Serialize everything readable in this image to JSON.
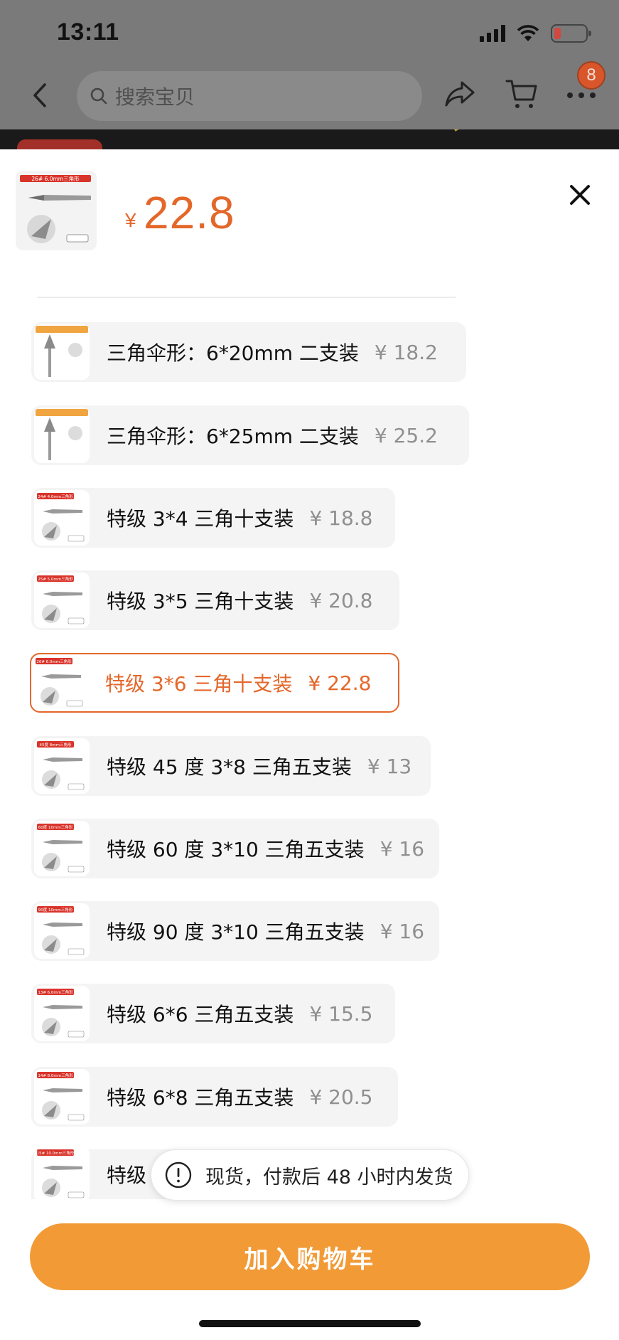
{
  "status_bar": {
    "time": "13:11"
  },
  "nav": {
    "search_placeholder": "搜索宝贝",
    "cart_badge": "8"
  },
  "header": {
    "thumb_tag": "26# 6.0mm三角形",
    "currency": "¥",
    "price": "22.8"
  },
  "options": [
    {
      "label": "三角伞形：6*20mm 二支装",
      "price": "¥ 18.2",
      "selected": false,
      "thumb_tag": ""
    },
    {
      "label": "三角伞形：6*25mm 二支装",
      "price": "¥ 25.2",
      "selected": false,
      "thumb_tag": ""
    },
    {
      "label": "特级 3*4 三角十支装",
      "price": "¥ 18.8",
      "selected": false,
      "thumb_tag": "24# 4.0mm三角形"
    },
    {
      "label": "特级 3*5 三角十支装",
      "price": "¥ 20.8",
      "selected": false,
      "thumb_tag": "25# 5.0mm三角形"
    },
    {
      "label": "特级 3*6 三角十支装",
      "price": "¥ 22.8",
      "selected": true,
      "thumb_tag": "26# 6.0mm三角形"
    },
    {
      "label": "特级 45 度 3*8 三角五支装",
      "price": "¥ 13",
      "selected": false,
      "thumb_tag": "45度 8mm三角形"
    },
    {
      "label": "特级 60 度 3*10 三角五支装",
      "price": "¥ 16",
      "selected": false,
      "thumb_tag": "60度 10mm三角形"
    },
    {
      "label": "特级 90 度 3*10 三角五支装",
      "price": "¥ 16",
      "selected": false,
      "thumb_tag": "90度 10mm三角形"
    },
    {
      "label": "特级 6*6 三角五支装",
      "price": "¥ 15.5",
      "selected": false,
      "thumb_tag": "13# 6.0mm三角形"
    },
    {
      "label": "特级 6*8 三角五支装",
      "price": "¥ 20.5",
      "selected": false,
      "thumb_tag": "14# 8.0mm三角形"
    },
    {
      "label": "特级",
      "price": "",
      "selected": false,
      "thumb_tag": "15# 10.0mm三角形"
    }
  ],
  "toast": {
    "text": "现货，付款后 48 小时内发货"
  },
  "actions": {
    "add_to_cart": "加入购物车"
  },
  "colors": {
    "accent": "#e4672a",
    "button": "#f29a36",
    "price_gray": "#8f8f8f",
    "tag_red": "#d9342b"
  },
  "icons": [
    "back-icon",
    "search-icon",
    "share-icon",
    "cart-icon",
    "more-icon",
    "close-icon",
    "alert-icon",
    "signal-icon",
    "wifi-icon",
    "battery-icon"
  ]
}
